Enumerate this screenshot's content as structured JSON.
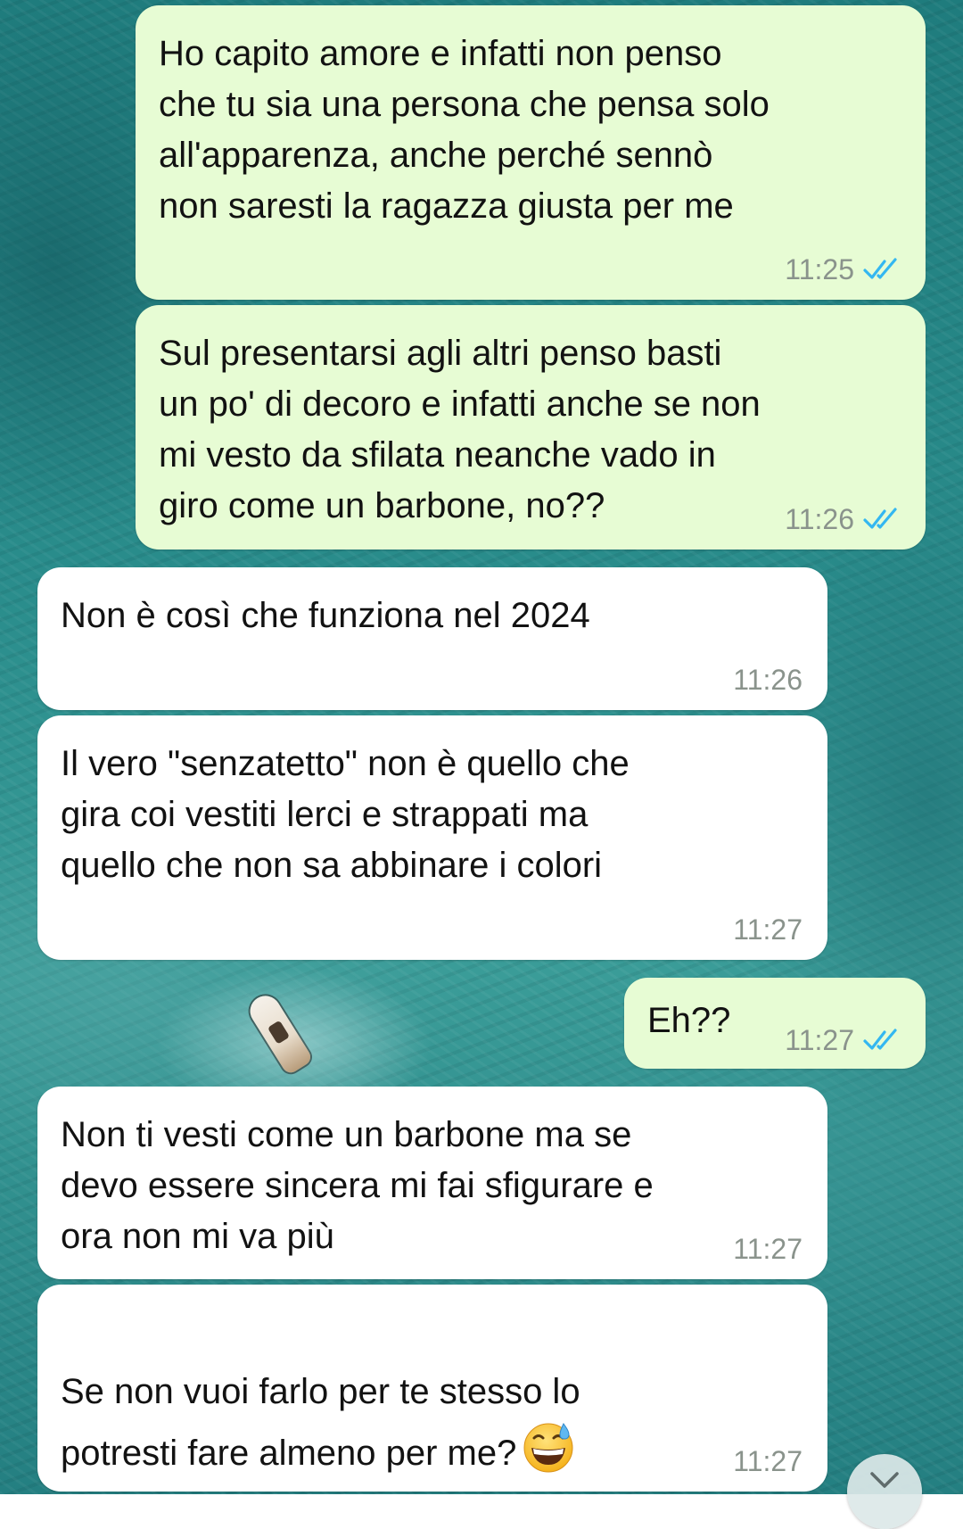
{
  "app": {
    "accent_tick_color": "#34b7f1",
    "outgoing_bubble_color": "#e7fcd4",
    "incoming_bubble_color": "#ffffff"
  },
  "messages": [
    {
      "direction": "outgoing",
      "text": "Ho capito amore e infatti non penso\nche tu sia una persona che pensa solo\nall'apparenza, anche perché sennò\nnon saresti la ragazza giusta per me",
      "time": "11:25",
      "status": "read"
    },
    {
      "direction": "outgoing",
      "text": "Sul presentarsi agli altri penso basti\nun po' di decoro e infatti anche se non\nmi vesto da sfilata neanche vado in\ngiro come un barbone, no??",
      "time": "11:26",
      "status": "read"
    },
    {
      "direction": "incoming",
      "text": "Non è così che funziona nel 2024",
      "time": "11:26"
    },
    {
      "direction": "incoming",
      "text": "Il vero \"senzatetto\" non è quello che\ngira coi vestiti lerci e strappati ma\nquello che non sa abbinare i colori",
      "time": "11:27"
    },
    {
      "direction": "outgoing",
      "text": "Eh??",
      "time": "11:27",
      "status": "read"
    },
    {
      "direction": "incoming",
      "text": "Non ti vesti come un barbone ma se\ndevo essere sincera mi fai sfigurare e\nora non mi va più",
      "time": "11:27"
    },
    {
      "direction": "incoming",
      "text": "Se non vuoi farlo per te stesso lo\npotresti fare almeno per me?",
      "emoji": "grinning-face-with-sweat-icon",
      "time": "11:27"
    }
  ],
  "icons": {
    "read_ticks": "double-check-icon",
    "scroll_down": "chevron-down-icon"
  }
}
